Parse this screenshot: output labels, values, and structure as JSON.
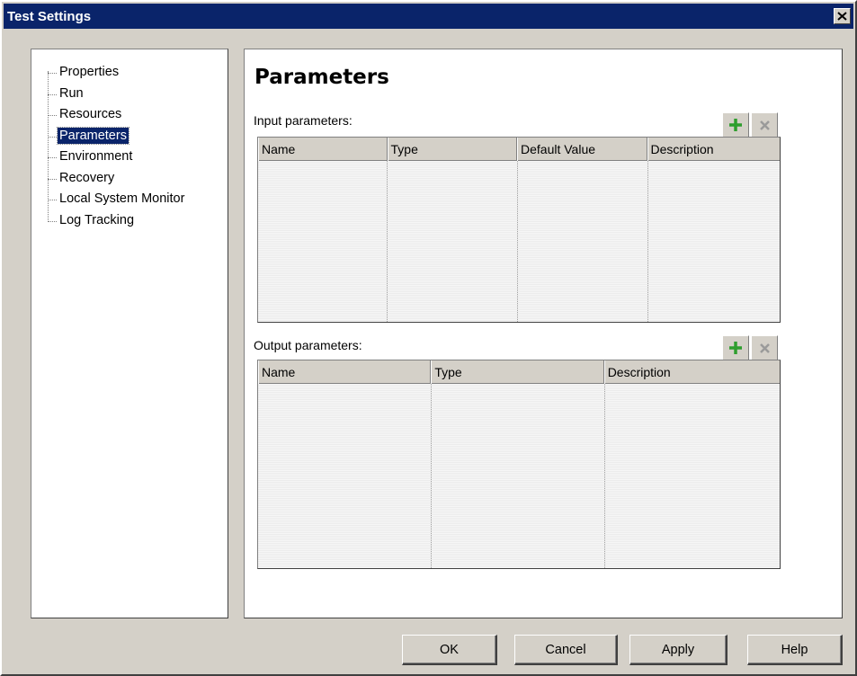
{
  "window": {
    "title": "Test Settings"
  },
  "icons": {
    "close": "close-icon",
    "add": "plus-icon",
    "remove": "x-icon"
  },
  "colors": {
    "titlebar": "#0a246a",
    "selection": "#0a246a",
    "add_icon": "#2e9e2e",
    "remove_icon": "#9a9a9a"
  },
  "nav": {
    "items": [
      {
        "label": "Properties",
        "selected": false
      },
      {
        "label": "Run",
        "selected": false
      },
      {
        "label": "Resources",
        "selected": false
      },
      {
        "label": "Parameters",
        "selected": true
      },
      {
        "label": "Environment",
        "selected": false
      },
      {
        "label": "Recovery",
        "selected": false
      },
      {
        "label": "Local System Monitor",
        "selected": false
      },
      {
        "label": "Log Tracking",
        "selected": false
      }
    ]
  },
  "main": {
    "title": "Parameters",
    "input": {
      "label": "Input parameters:",
      "columns": [
        "Name",
        "Type",
        "Default Value",
        "Description"
      ],
      "rows": []
    },
    "output": {
      "label": "Output parameters:",
      "columns": [
        "Name",
        "Type",
        "Description"
      ],
      "rows": []
    }
  },
  "buttons": {
    "ok": "OK",
    "cancel": "Cancel",
    "apply": "Apply",
    "help": "Help"
  }
}
